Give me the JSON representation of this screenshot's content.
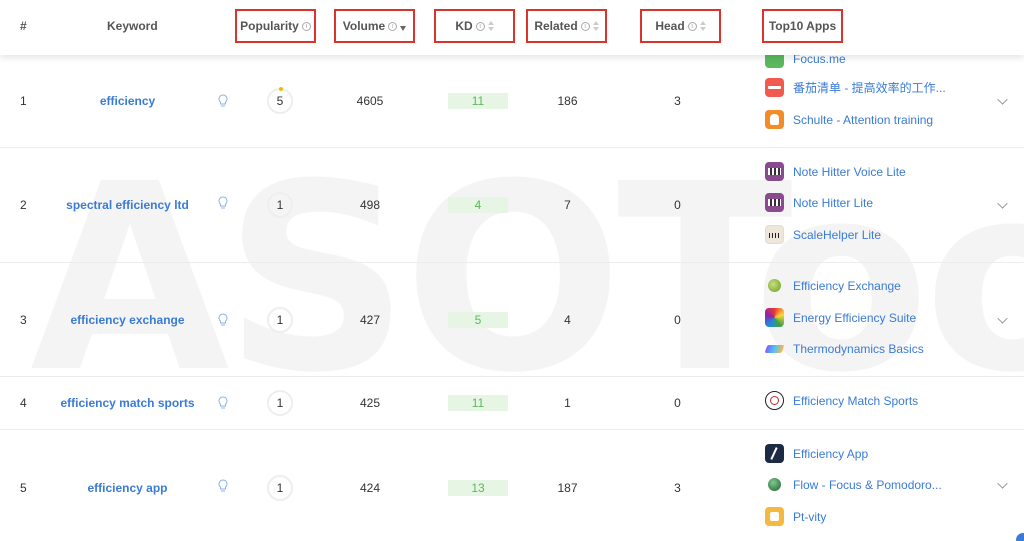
{
  "header": {
    "num": "#",
    "keyword": "Keyword",
    "popularity": "Popularity",
    "volume": "Volume",
    "kd": "KD",
    "related": "Related",
    "head": "Head",
    "top10": "Top10 Apps"
  },
  "watermark": "ASOTools",
  "rows": [
    {
      "num": "1",
      "keyword": "efficiency",
      "popularity": "5",
      "volume": "4605",
      "kd": "11",
      "related": "186",
      "head": "3",
      "apps": [
        {
          "name": "Focus.me",
          "icon": "focusme-icon"
        },
        {
          "name": "番茄清单 - 提高效率的工作...",
          "icon": "tomato-list-icon"
        },
        {
          "name": "Schulte - Attention training",
          "icon": "schulte-icon"
        }
      ]
    },
    {
      "num": "2",
      "keyword": "spectral efficiency ltd",
      "popularity": "1",
      "volume": "498",
      "kd": "4",
      "related": "7",
      "head": "0",
      "apps": [
        {
          "name": "Note Hitter Voice Lite",
          "icon": "note-hitter-voice-icon"
        },
        {
          "name": "Note Hitter Lite",
          "icon": "note-hitter-icon"
        },
        {
          "name": "ScaleHelper Lite",
          "icon": "scalehelper-icon"
        }
      ]
    },
    {
      "num": "3",
      "keyword": "efficiency exchange",
      "popularity": "1",
      "volume": "427",
      "kd": "5",
      "related": "4",
      "head": "0",
      "apps": [
        {
          "name": "Efficiency Exchange",
          "icon": "efficiency-exchange-icon"
        },
        {
          "name": "Energy Efficiency Suite",
          "icon": "energy-suite-icon"
        },
        {
          "name": "Thermodynamics Basics",
          "icon": "thermodynamics-icon"
        }
      ]
    },
    {
      "num": "4",
      "keyword": "efficiency match sports",
      "popularity": "1",
      "volume": "425",
      "kd": "11",
      "related": "1",
      "head": "0",
      "apps": [
        {
          "name": "Efficiency Match Sports",
          "icon": "match-sports-icon"
        }
      ]
    },
    {
      "num": "5",
      "keyword": "efficiency app",
      "popularity": "1",
      "volume": "424",
      "kd": "13",
      "related": "187",
      "head": "3",
      "apps": [
        {
          "name": "Efficiency App",
          "icon": "efficiency-app-icon"
        },
        {
          "name": "Flow - Focus & Pomodoro...",
          "icon": "flow-icon"
        },
        {
          "name": "Pt-vity",
          "icon": "ptvity-icon"
        }
      ]
    }
  ],
  "colors": {
    "link": "#3a7bd5",
    "highlight_box": "#d9342b",
    "kd_bg": "#e7f6e4",
    "kd_text": "#5cb85c",
    "popularity_dot": "#f5b800"
  }
}
